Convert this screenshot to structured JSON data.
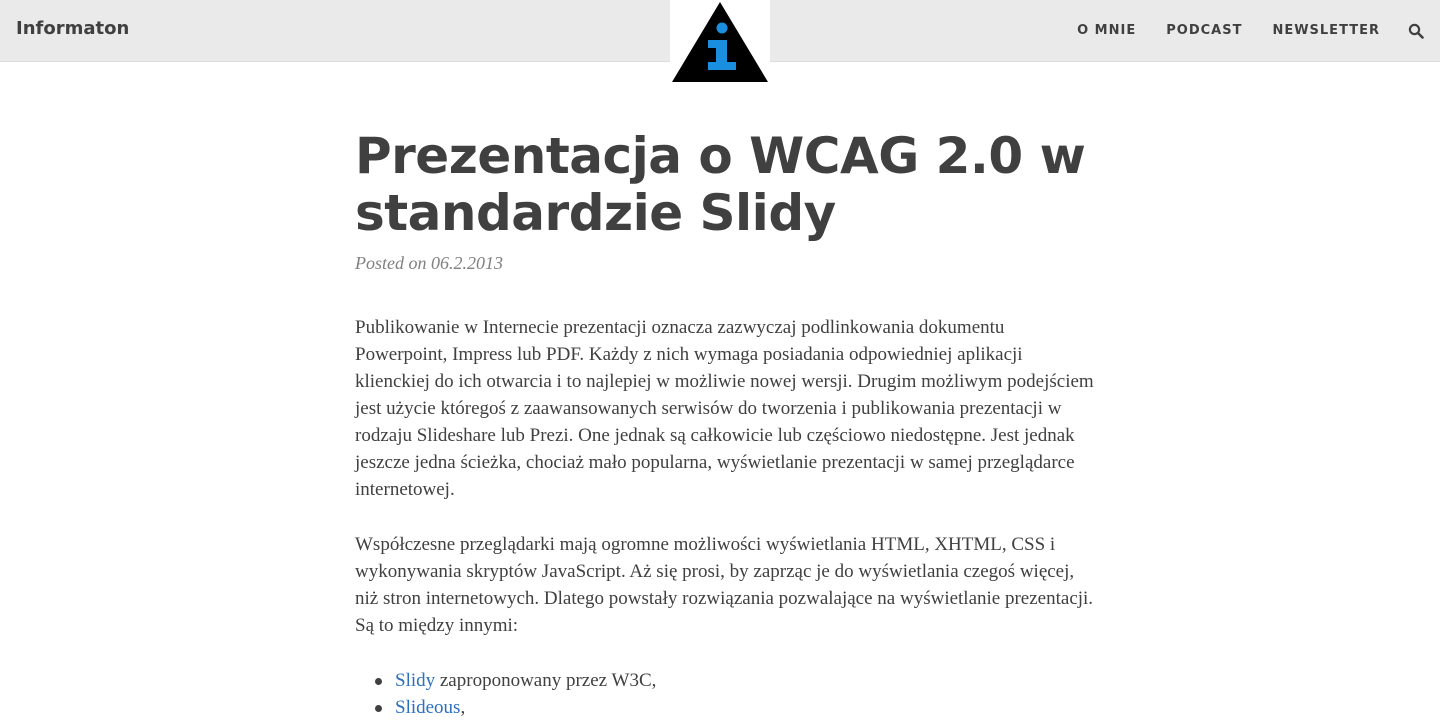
{
  "header": {
    "brand": "Informaton",
    "logo_icon": "info-triangle-logo-icon",
    "nav": [
      {
        "label": "O MNIE"
      },
      {
        "label": "PODCAST"
      },
      {
        "label": "NEWSLETTER"
      }
    ],
    "search_icon": "search-icon"
  },
  "article": {
    "title": "Prezentacja o WCAG 2.0 w standardzie Slidy",
    "posted_prefix": "Posted on ",
    "date": "06.2.2013",
    "paragraphs": [
      "Publikowanie w Internecie prezentacji oznacza zazwyczaj podlinkowania dokumentu Powerpoint, Impress lub PDF. Każdy z nich wymaga posiadania odpowiedniej aplikacji klienckiej do ich otwarcia i to najlepiej w możliwie nowej wersji. Drugim możliwym podejściem jest użycie któregoś z zaawansowanych serwisów do tworzenia i publikowania prezentacji w rodzaju Slideshare lub Prezi. One jednak są całkowicie lub częściowo niedostępne. Jest jednak jeszcze jedna ścieżka, chociaż mało popularna, wyświetlanie prezentacji w samej przeglądarce internetowej.",
      "Współczesne przeglądarki mają ogromne możliwości wyświetlania HTML, XHTML, CSS i wykonywania skryptów JavaScript. Aż się prosi, by zaprząc je do wyświetlania czegoś więcej, niż stron internetowych. Dlatego powstały rozwiązania pozwalające na wyświetlanie prezentacji. Są to między innymi:"
    ],
    "list": [
      {
        "link": "Slidy",
        "text": " zaproponowany przez W3C,"
      },
      {
        "link": "Slideous",
        "text": ","
      }
    ]
  },
  "colors": {
    "header_bg": "#eaeaea",
    "text": "#404040",
    "meta": "#808080",
    "link": "#2a6fc0",
    "logo_accent": "#1a8fe0"
  }
}
